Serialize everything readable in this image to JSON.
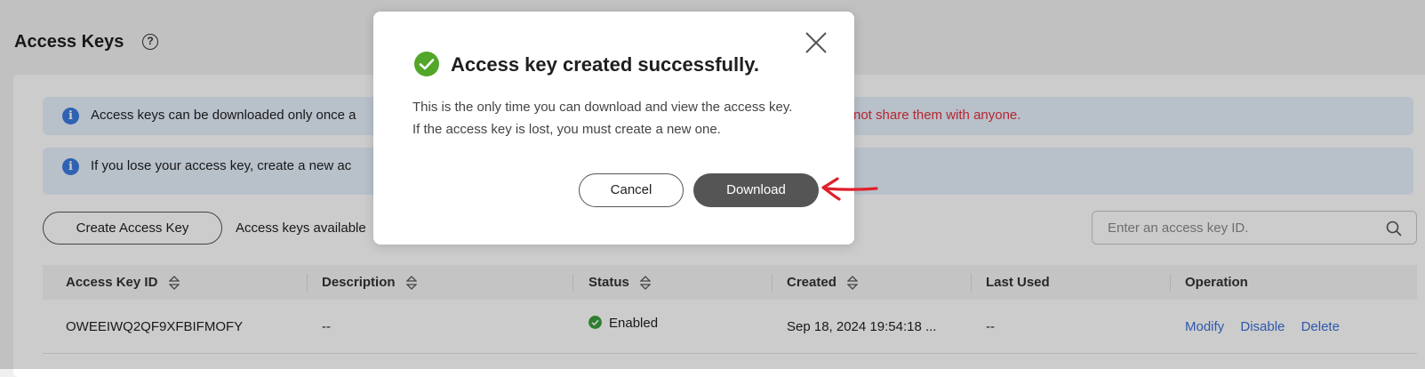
{
  "page": {
    "title": "Access Keys",
    "help_icon": "question-circle-icon"
  },
  "notices": [
    {
      "icon": "info-icon",
      "text": "Access keys can be downloaded only once a",
      "warning": "not share them with anyone."
    },
    {
      "icon": "info-icon",
      "text": "If you lose your access key, create a new ac"
    }
  ],
  "toolbar": {
    "create_label": "Create Access Key",
    "available_text": "Access keys available",
    "search_placeholder": "Enter an access key ID."
  },
  "table": {
    "columns": [
      "Access Key ID",
      "Description",
      "Status",
      "Created",
      "Last Used",
      "Operation"
    ],
    "rows": [
      {
        "access_key_id": "OWEEIWQ2QF9XFBIFMOFY",
        "description": "--",
        "status": "Enabled",
        "created": "Sep 18, 2024 19:54:18 ...",
        "last_used": "--",
        "operations": [
          "Modify",
          "Disable",
          "Delete"
        ]
      }
    ]
  },
  "modal": {
    "title": "Access key created successfully.",
    "body": "This is the only time you can download and view the access key. If the access key is lost, you must create a new one.",
    "cancel_label": "Cancel",
    "download_label": "Download"
  },
  "colors": {
    "accent_link": "#3d6fd6",
    "success": "#52a629",
    "warning_text": "#e0313c",
    "annotation_arrow": "#e0202a"
  }
}
